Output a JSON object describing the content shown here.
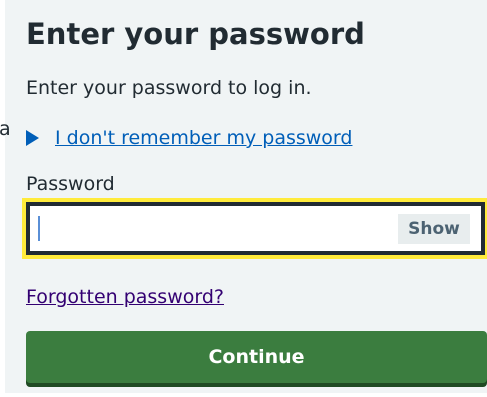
{
  "stray_text": "a",
  "heading": "Enter your password",
  "intro": "Enter your password to log in.",
  "details": {
    "icon": "triangle-right-icon",
    "summary": "I don't remember my password"
  },
  "password": {
    "label": "Password",
    "value": "",
    "show_label": "Show"
  },
  "forgotten_link": "Forgotten password?",
  "continue_label": "Continue",
  "colors": {
    "background": "#f0f4f5",
    "text": "#212b32",
    "link": "#005eb8",
    "visited_link": "#330072",
    "focus": "#ffeb3b",
    "button": "#3b7d3f",
    "button_shadow": "#1f4a23"
  }
}
